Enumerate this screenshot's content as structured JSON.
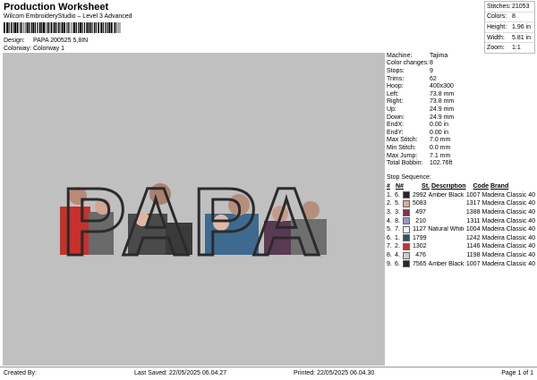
{
  "header": {
    "title": "Production Worksheet",
    "subtitle": "Wilcom EmbroideryStudio – Level 3 Advanced",
    "design_label": "Design:",
    "design_value": "PAPA 200525 5,8IN",
    "colorway_label": "Colorway:",
    "colorway_value": "Colorway 1"
  },
  "stats": [
    {
      "label": "Stitches:",
      "value": "21053"
    },
    {
      "label": "Colors:",
      "value": "8"
    },
    {
      "label": "Height:",
      "value": "1.96 in"
    },
    {
      "label": "Width:",
      "value": "5.81 in"
    },
    {
      "label": "Zoom:",
      "value": "1:1"
    }
  ],
  "design_text": "PAPA",
  "properties": [
    {
      "label": "Machine:",
      "value": "Tajima"
    },
    {
      "label": "Color changes:",
      "value": "8"
    },
    {
      "label": "Stops:",
      "value": "9"
    },
    {
      "label": "Trims:",
      "value": "62"
    },
    {
      "label": "Hoop:",
      "value": "400x300"
    },
    {
      "label": "Left:",
      "value": "73.8 mm"
    },
    {
      "label": "Right:",
      "value": "73.8 mm"
    },
    {
      "label": "Up:",
      "value": "24.9 mm"
    },
    {
      "label": "Down:",
      "value": "24.9 mm"
    },
    {
      "label": "EndX:",
      "value": "0.00 in"
    },
    {
      "label": "EndY:",
      "value": "0.00 in"
    },
    {
      "label": "Max Stitch:",
      "value": "7.0 mm"
    },
    {
      "label": "Min Stitch:",
      "value": "0.0 mm"
    },
    {
      "label": "Max Jump:",
      "value": "7.1 mm"
    },
    {
      "label": "Total Bobbin:",
      "value": "102.76ft"
    }
  ],
  "stop_sequence": {
    "title": "Stop Sequence:",
    "headers": {
      "num": "#",
      "n": "N#",
      "st": "St.",
      "desc": "Description",
      "code": "Code",
      "brand": "Brand"
    },
    "rows": [
      {
        "num": "1.",
        "n": "6.",
        "color": "#2a2426",
        "st": "2992",
        "desc": "Amber Black",
        "code": "1007",
        "brand": "Madeira Classic 40"
      },
      {
        "num": "2.",
        "n": "5.",
        "color": "#e1a79b",
        "st": "5083",
        "desc": "",
        "code": "1317",
        "brand": "Madeira Classic 40"
      },
      {
        "num": "3.",
        "n": "3.",
        "color": "#8a2f45",
        "st": "497",
        "desc": "",
        "code": "1388",
        "brand": "Madeira Classic 40"
      },
      {
        "num": "4.",
        "n": "8.",
        "color": "#9a94c8",
        "st": "210",
        "desc": "",
        "code": "1311",
        "brand": "Madeira Classic 40"
      },
      {
        "num": "5.",
        "n": "7.",
        "color": "#f4f4f4",
        "st": "1127",
        "desc": "Natural White",
        "code": "1004",
        "brand": "Madeira Classic 40"
      },
      {
        "num": "6.",
        "n": "1.",
        "color": "#2e4f73",
        "st": "1799",
        "desc": "",
        "code": "1242",
        "brand": "Madeira Classic 40"
      },
      {
        "num": "7.",
        "n": "2.",
        "color": "#d42b2b",
        "st": "1302",
        "desc": "",
        "code": "1146",
        "brand": "Madeira Classic 40"
      },
      {
        "num": "8.",
        "n": "4.",
        "color": "#d8c8cc",
        "st": "476",
        "desc": "",
        "code": "1198",
        "brand": "Madeira Classic 40"
      },
      {
        "num": "9.",
        "n": "6.",
        "color": "#2a2426",
        "st": "7565",
        "desc": "Amber Black",
        "code": "1007",
        "brand": "Madeira Classic 40"
      }
    ]
  },
  "footer": {
    "created": "Created By:",
    "saved": "Last Saved: 22/05/2025 06.04.27",
    "printed": "Printed: 22/05/2025 06.04.30",
    "page": "Page 1 of 1"
  },
  "colors": {
    "canvas": "#c0c0c0",
    "letter_outline": "#2b2b2b"
  }
}
